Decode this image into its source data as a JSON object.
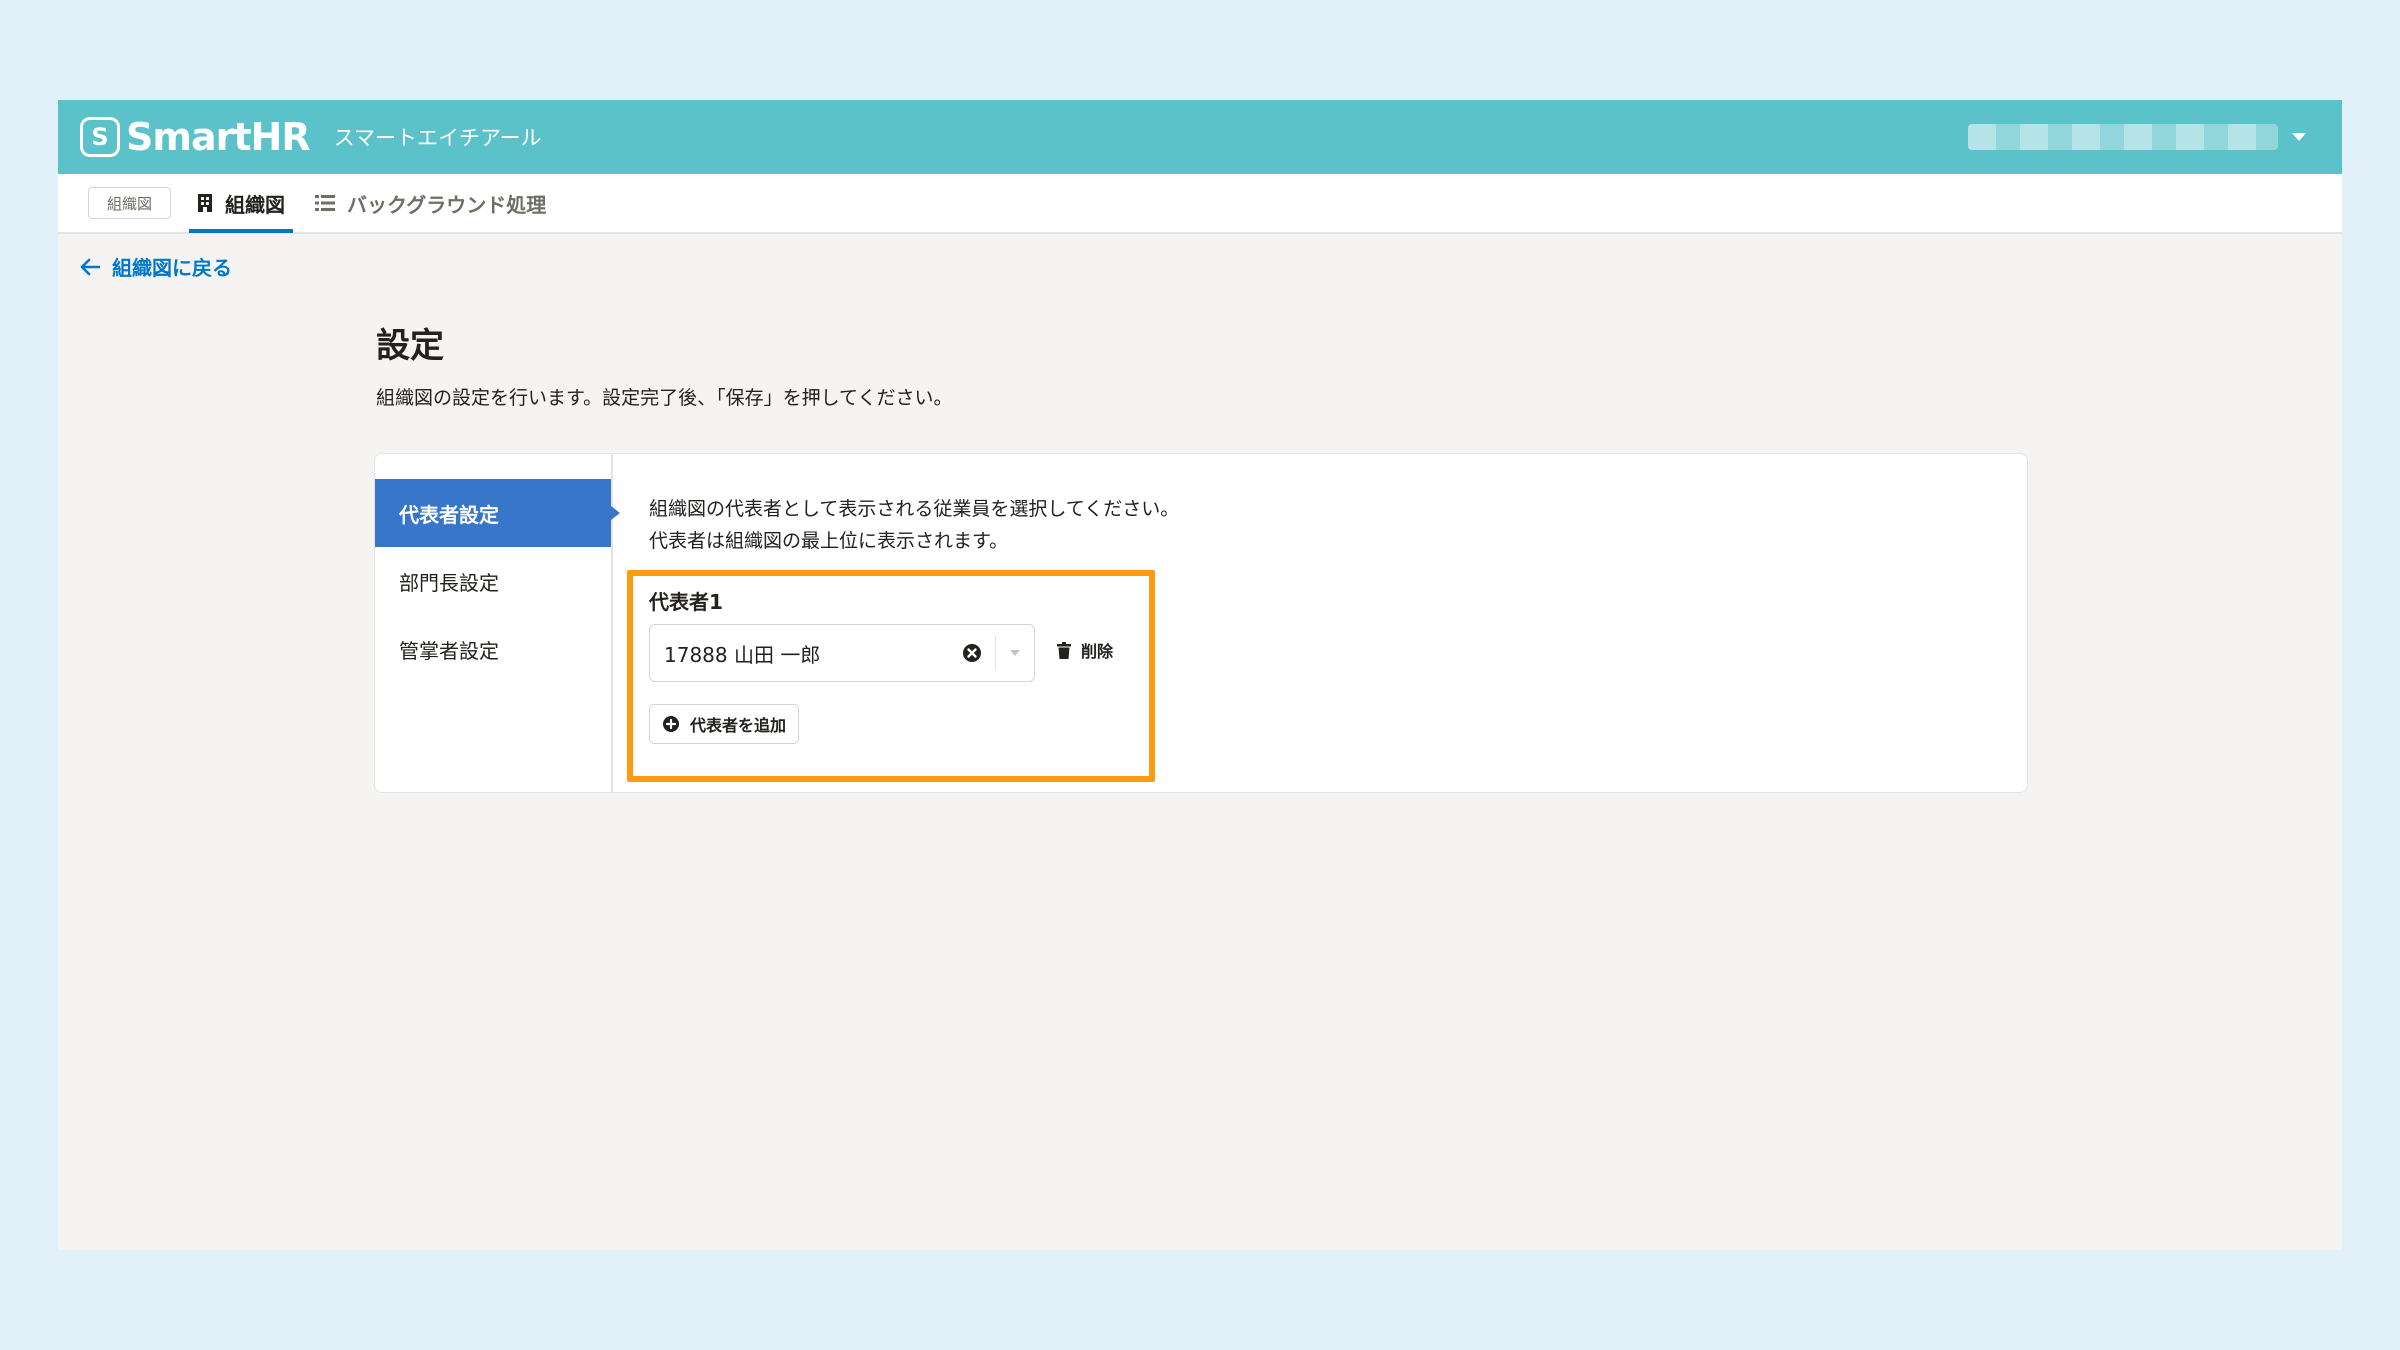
{
  "header": {
    "logo_mark": "S",
    "logo_text": "SmartHR",
    "tenant_name": "スマートエイチアール",
    "account_icon": "chevron-down-icon"
  },
  "subnav": {
    "app_chip": "組織図",
    "tabs": [
      {
        "label": "組織図",
        "icon": "building-icon",
        "active": true
      },
      {
        "label": "バックグラウンド処理",
        "icon": "list-icon",
        "active": false
      }
    ]
  },
  "back_link": {
    "label": "組織図に戻る",
    "icon": "arrow-left-icon"
  },
  "page": {
    "title": "設定",
    "description": "組織図の設定を行います。設定完了後、「保存」を押してください。"
  },
  "settings_menu": {
    "items": [
      {
        "label": "代表者設定",
        "active": true
      },
      {
        "label": "部門長設定",
        "active": false
      },
      {
        "label": "管掌者設定",
        "active": false
      }
    ]
  },
  "representative": {
    "description_line1": "組織図の代表者として表示される従業員を選択してください。",
    "description_line2": "代表者は組織図の最上位に表示されます。",
    "field_label": "代表者1",
    "selected_value": "17888 山田 一郎",
    "delete_label": "削除",
    "add_label": "代表者を追加"
  },
  "colors": {
    "header": "#5bc2c9",
    "accent": "#0077c7",
    "active_menu": "#3776c8",
    "highlight": "#ff9b0f"
  }
}
